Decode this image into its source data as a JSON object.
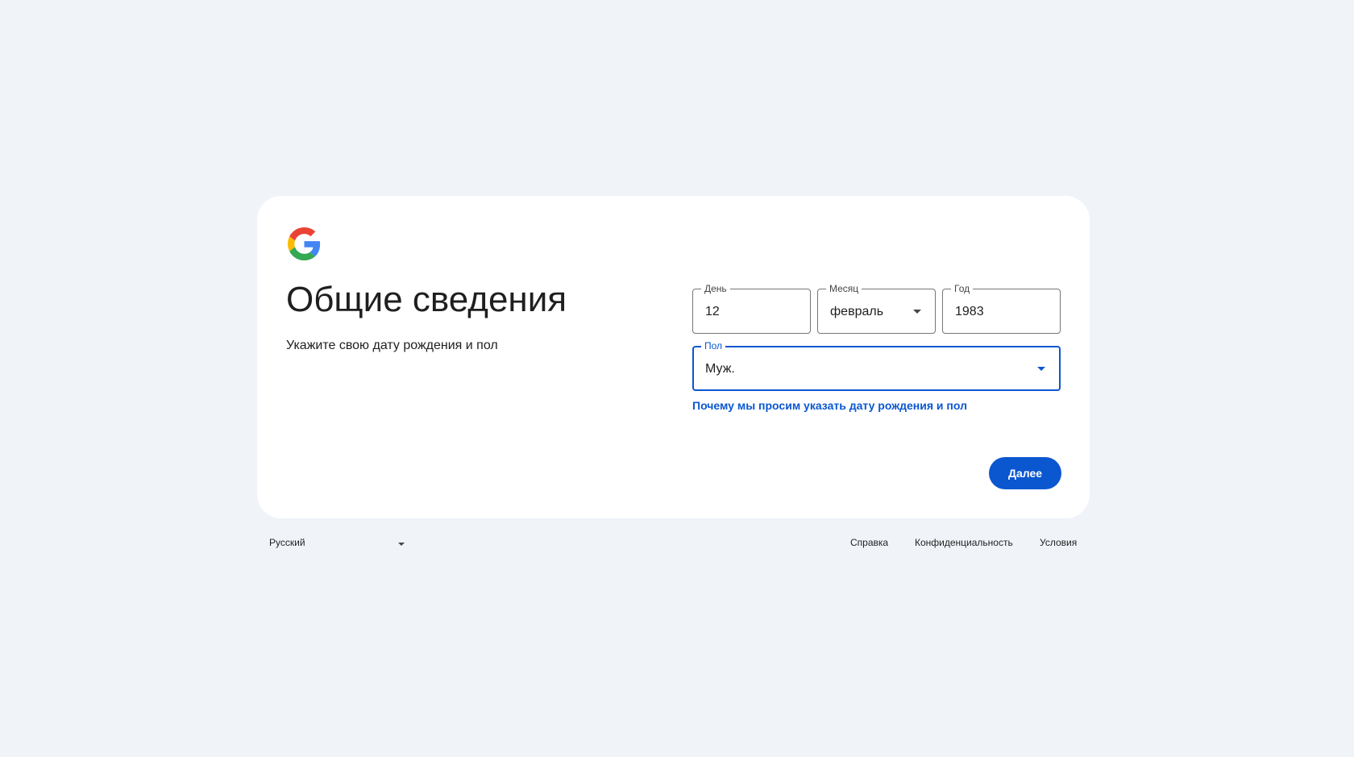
{
  "brand": {
    "logo_icon": "google-g-logo-icon"
  },
  "page": {
    "title": "Общие сведения",
    "subtitle": "Укажите свою дату рождения и пол"
  },
  "form": {
    "day": {
      "label": "День",
      "value": "12"
    },
    "month": {
      "label": "Месяц",
      "value": "февраль",
      "icon": "chevron-down-icon"
    },
    "year": {
      "label": "Год",
      "value": "1983"
    },
    "gender": {
      "label": "Пол",
      "value": "Муж.",
      "icon": "chevron-down-icon"
    },
    "why_link": "Почему мы просим указать дату рождения и пол",
    "next_label": "Далее"
  },
  "footer": {
    "language": "Русский",
    "links": [
      "Справка",
      "Конфиденциальность",
      "Условия"
    ]
  },
  "colors": {
    "background": "#f0f4f9",
    "card": "#ffffff",
    "accent": "#0b57d0",
    "text": "#1f1f1f",
    "border": "#747775"
  }
}
